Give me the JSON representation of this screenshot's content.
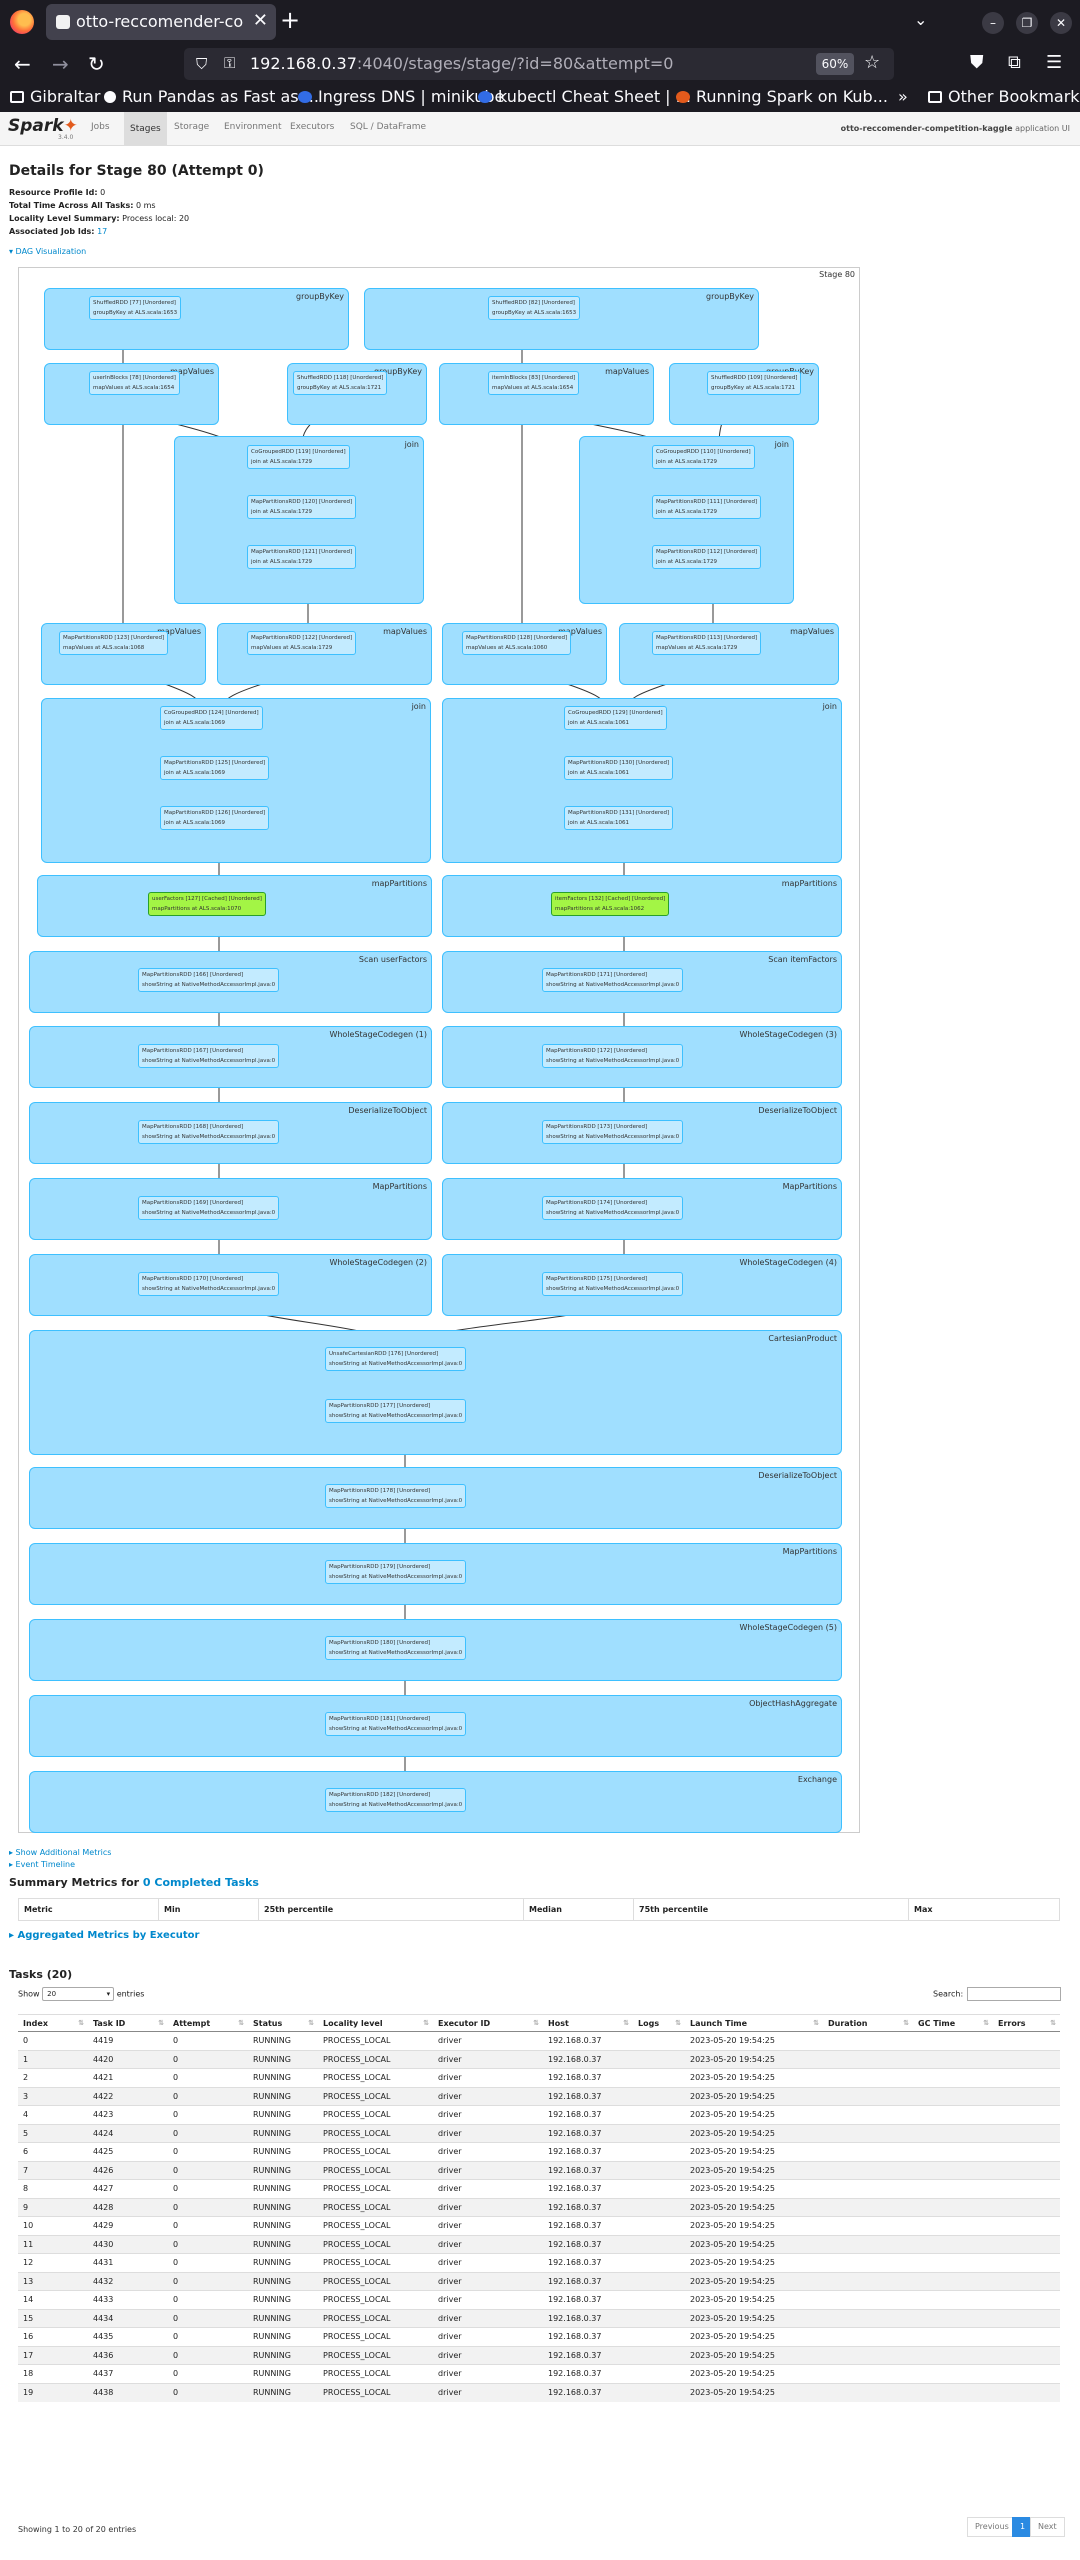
{
  "browser": {
    "tab_title": "otto-reccomender-compe",
    "url_host": "192.168.0.37",
    "url_path": ":4040/stages/stage/?id=80&attempt=0",
    "zoom": "60%",
    "bookmarks": [
      "Gibraltar",
      "Run Pandas as Fast as ...",
      "Ingress DNS | minikube",
      "kubectl Cheat Sheet | ...",
      "Running Spark on Kub...",
      "Other Bookmarks"
    ]
  },
  "spark": {
    "version": "3.4.0",
    "tabs": [
      "Jobs",
      "Stages",
      "Storage",
      "Environment",
      "Executors",
      "SQL / DataFrame"
    ],
    "app_name": "otto-reccomender-competition-kaggle",
    "app_suffix": "application UI"
  },
  "stage": {
    "title": "Details for Stage 80 (Attempt 0)",
    "resource_profile_label": "Resource Profile Id:",
    "resource_profile": "0",
    "total_time_label": "Total Time Across All Tasks:",
    "total_time": "0 ms",
    "locality_label": "Locality Level Summary:",
    "locality": "Process local: 20",
    "jobs_label": "Associated Job Ids:",
    "job_ids": "17",
    "dag_toggle": "▾ DAG Visualization",
    "dag_label": "Stage 80"
  },
  "dag": {
    "clusters": [
      {
        "label": "groupByKey",
        "nodes": [
          {
            "l1": "ShuffledRDD [77] [Unordered]",
            "l2": "groupByKey at ALS.scala:1653"
          }
        ]
      },
      {
        "label": "groupByKey",
        "nodes": [
          {
            "l1": "ShuffledRDD [82] [Unordered]",
            "l2": "groupByKey at ALS.scala:1653"
          }
        ]
      },
      {
        "label": "mapValues",
        "nodes": [
          {
            "l1": "userInBlocks [78] [Unordered]",
            "l2": "mapValues at ALS.scala:1654"
          }
        ]
      },
      {
        "label": "groupByKey",
        "nodes": [
          {
            "l1": "ShuffledRDD [118] [Unordered]",
            "l2": "groupByKey at ALS.scala:1721"
          }
        ]
      },
      {
        "label": "mapValues",
        "nodes": [
          {
            "l1": "itemInBlocks [83] [Unordered]",
            "l2": "mapValues at ALS.scala:1654"
          }
        ]
      },
      {
        "label": "groupByKey",
        "nodes": [
          {
            "l1": "ShuffledRDD [109] [Unordered]",
            "l2": "groupByKey at ALS.scala:1721"
          }
        ]
      },
      {
        "label": "join",
        "nodes": [
          {
            "l1": "CoGroupedRDD [119] [Unordered]",
            "l2": "join at ALS.scala:1729"
          },
          {
            "l1": "MapPartitionsRDD [120] [Unordered]",
            "l2": "join at ALS.scala:1729"
          },
          {
            "l1": "MapPartitionsRDD [121] [Unordered]",
            "l2": "join at ALS.scala:1729"
          }
        ]
      },
      {
        "label": "join",
        "nodes": [
          {
            "l1": "CoGroupedRDD [110] [Unordered]",
            "l2": "join at ALS.scala:1729"
          },
          {
            "l1": "MapPartitionsRDD [111] [Unordered]",
            "l2": "join at ALS.scala:1729"
          },
          {
            "l1": "MapPartitionsRDD [112] [Unordered]",
            "l2": "join at ALS.scala:1729"
          }
        ]
      },
      {
        "label": "mapValues",
        "nodes": [
          {
            "l1": "MapPartitionsRDD [123] [Unordered]",
            "l2": "mapValues at ALS.scala:1068"
          }
        ]
      },
      {
        "label": "mapValues",
        "nodes": [
          {
            "l1": "MapPartitionsRDD [122] [Unordered]",
            "l2": "mapValues at ALS.scala:1729"
          }
        ]
      },
      {
        "label": "mapValues",
        "nodes": [
          {
            "l1": "MapPartitionsRDD [128] [Unordered]",
            "l2": "mapValues at ALS.scala:1060"
          }
        ]
      },
      {
        "label": "mapValues",
        "nodes": [
          {
            "l1": "MapPartitionsRDD [113] [Unordered]",
            "l2": "mapValues at ALS.scala:1729"
          }
        ]
      },
      {
        "label": "join",
        "nodes": [
          {
            "l1": "CoGroupedRDD [124] [Unordered]",
            "l2": "join at ALS.scala:1069"
          },
          {
            "l1": "MapPartitionsRDD [125] [Unordered]",
            "l2": "join at ALS.scala:1069"
          },
          {
            "l1": "MapPartitionsRDD [126] [Unordered]",
            "l2": "join at ALS.scala:1069"
          }
        ]
      },
      {
        "label": "join",
        "nodes": [
          {
            "l1": "CoGroupedRDD [129] [Unordered]",
            "l2": "join at ALS.scala:1061"
          },
          {
            "l1": "MapPartitionsRDD [130] [Unordered]",
            "l2": "join at ALS.scala:1061"
          },
          {
            "l1": "MapPartitionsRDD [131] [Unordered]",
            "l2": "join at ALS.scala:1061"
          }
        ]
      },
      {
        "label": "mapPartitions",
        "nodes": [
          {
            "l1": "userFactors [127] [Cached] [Unordered]",
            "l2": "mapPartitions at ALS.scala:1070",
            "cached": true
          }
        ]
      },
      {
        "label": "mapPartitions",
        "nodes": [
          {
            "l1": "itemFactors [132] [Cached] [Unordered]",
            "l2": "mapPartitions at ALS.scala:1062",
            "cached": true
          }
        ]
      },
      {
        "label": "Scan userFactors",
        "nodes": [
          {
            "l1": "MapPartitionsRDD [166] [Unordered]",
            "l2": "showString at NativeMethodAccessorImpl.java:0"
          }
        ]
      },
      {
        "label": "Scan itemFactors",
        "nodes": [
          {
            "l1": "MapPartitionsRDD [171] [Unordered]",
            "l2": "showString at NativeMethodAccessorImpl.java:0"
          }
        ]
      },
      {
        "label": "WholeStageCodegen (1)",
        "nodes": [
          {
            "l1": "MapPartitionsRDD [167] [Unordered]",
            "l2": "showString at NativeMethodAccessorImpl.java:0"
          }
        ]
      },
      {
        "label": "WholeStageCodegen (3)",
        "nodes": [
          {
            "l1": "MapPartitionsRDD [172] [Unordered]",
            "l2": "showString at NativeMethodAccessorImpl.java:0"
          }
        ]
      },
      {
        "label": "DeserializeToObject",
        "nodes": [
          {
            "l1": "MapPartitionsRDD [168] [Unordered]",
            "l2": "showString at NativeMethodAccessorImpl.java:0"
          }
        ]
      },
      {
        "label": "DeserializeToObject",
        "nodes": [
          {
            "l1": "MapPartitionsRDD [173] [Unordered]",
            "l2": "showString at NativeMethodAccessorImpl.java:0"
          }
        ]
      },
      {
        "label": "MapPartitions",
        "nodes": [
          {
            "l1": "MapPartitionsRDD [169] [Unordered]",
            "l2": "showString at NativeMethodAccessorImpl.java:0"
          }
        ]
      },
      {
        "label": "MapPartitions",
        "nodes": [
          {
            "l1": "MapPartitionsRDD [174] [Unordered]",
            "l2": "showString at NativeMethodAccessorImpl.java:0"
          }
        ]
      },
      {
        "label": "WholeStageCodegen (2)",
        "nodes": [
          {
            "l1": "MapPartitionsRDD [170] [Unordered]",
            "l2": "showString at NativeMethodAccessorImpl.java:0"
          }
        ]
      },
      {
        "label": "WholeStageCodegen (4)",
        "nodes": [
          {
            "l1": "MapPartitionsRDD [175] [Unordered]",
            "l2": "showString at NativeMethodAccessorImpl.java:0"
          }
        ]
      },
      {
        "label": "CartesianProduct",
        "nodes": [
          {
            "l1": "UnsafeCartesianRDD [176] [Unordered]",
            "l2": "showString at NativeMethodAccessorImpl.java:0"
          },
          {
            "l1": "MapPartitionsRDD [177] [Unordered]",
            "l2": "showString at NativeMethodAccessorImpl.java:0"
          }
        ]
      },
      {
        "label": "DeserializeToObject",
        "nodes": [
          {
            "l1": "MapPartitionsRDD [178] [Unordered]",
            "l2": "showString at NativeMethodAccessorImpl.java:0"
          }
        ]
      },
      {
        "label": "MapPartitions",
        "nodes": [
          {
            "l1": "MapPartitionsRDD [179] [Unordered]",
            "l2": "showString at NativeMethodAccessorImpl.java:0"
          }
        ]
      },
      {
        "label": "WholeStageCodegen (5)",
        "nodes": [
          {
            "l1": "MapPartitionsRDD [180] [Unordered]",
            "l2": "showString at NativeMethodAccessorImpl.java:0"
          }
        ]
      },
      {
        "label": "ObjectHashAggregate",
        "nodes": [
          {
            "l1": "MapPartitionsRDD [181] [Unordered]",
            "l2": "showString at NativeMethodAccessorImpl.java:0"
          }
        ]
      },
      {
        "label": "Exchange",
        "nodes": [
          {
            "l1": "MapPartitionsRDD [182] [Unordered]",
            "l2": "showString at NativeMethodAccessorImpl.java:0"
          }
        ]
      }
    ]
  },
  "links": {
    "show_metrics": "▸ Show Additional Metrics",
    "event_timeline": "▸ Event Timeline"
  },
  "summary": {
    "title": "Summary Metrics for",
    "link": "0 Completed Tasks",
    "headers": [
      "Metric",
      "Min",
      "25th percentile",
      "Median",
      "75th percentile",
      "Max"
    ]
  },
  "aggregated": "▸ Aggregated Metrics by Executor",
  "tasks": {
    "title": "Tasks (20)",
    "show_label": "Show",
    "show_value": "20",
    "entries_label": "entries",
    "search_label": "Search:",
    "headers": [
      "Index",
      "Task ID",
      "Attempt",
      "Status",
      "Locality level",
      "Executor ID",
      "Host",
      "Logs",
      "Launch Time",
      "Duration",
      "GC Time",
      "Errors"
    ],
    "rows": [
      [
        "0",
        "4419",
        "0",
        "RUNNING",
        "PROCESS_LOCAL",
        "driver",
        "192.168.0.37",
        "",
        "2023-05-20 19:54:25",
        "",
        "",
        ""
      ],
      [
        "1",
        "4420",
        "0",
        "RUNNING",
        "PROCESS_LOCAL",
        "driver",
        "192.168.0.37",
        "",
        "2023-05-20 19:54:25",
        "",
        "",
        ""
      ],
      [
        "2",
        "4421",
        "0",
        "RUNNING",
        "PROCESS_LOCAL",
        "driver",
        "192.168.0.37",
        "",
        "2023-05-20 19:54:25",
        "",
        "",
        ""
      ],
      [
        "3",
        "4422",
        "0",
        "RUNNING",
        "PROCESS_LOCAL",
        "driver",
        "192.168.0.37",
        "",
        "2023-05-20 19:54:25",
        "",
        "",
        ""
      ],
      [
        "4",
        "4423",
        "0",
        "RUNNING",
        "PROCESS_LOCAL",
        "driver",
        "192.168.0.37",
        "",
        "2023-05-20 19:54:25",
        "",
        "",
        ""
      ],
      [
        "5",
        "4424",
        "0",
        "RUNNING",
        "PROCESS_LOCAL",
        "driver",
        "192.168.0.37",
        "",
        "2023-05-20 19:54:25",
        "",
        "",
        ""
      ],
      [
        "6",
        "4425",
        "0",
        "RUNNING",
        "PROCESS_LOCAL",
        "driver",
        "192.168.0.37",
        "",
        "2023-05-20 19:54:25",
        "",
        "",
        ""
      ],
      [
        "7",
        "4426",
        "0",
        "RUNNING",
        "PROCESS_LOCAL",
        "driver",
        "192.168.0.37",
        "",
        "2023-05-20 19:54:25",
        "",
        "",
        ""
      ],
      [
        "8",
        "4427",
        "0",
        "RUNNING",
        "PROCESS_LOCAL",
        "driver",
        "192.168.0.37",
        "",
        "2023-05-20 19:54:25",
        "",
        "",
        ""
      ],
      [
        "9",
        "4428",
        "0",
        "RUNNING",
        "PROCESS_LOCAL",
        "driver",
        "192.168.0.37",
        "",
        "2023-05-20 19:54:25",
        "",
        "",
        ""
      ],
      [
        "10",
        "4429",
        "0",
        "RUNNING",
        "PROCESS_LOCAL",
        "driver",
        "192.168.0.37",
        "",
        "2023-05-20 19:54:25",
        "",
        "",
        ""
      ],
      [
        "11",
        "4430",
        "0",
        "RUNNING",
        "PROCESS_LOCAL",
        "driver",
        "192.168.0.37",
        "",
        "2023-05-20 19:54:25",
        "",
        "",
        ""
      ],
      [
        "12",
        "4431",
        "0",
        "RUNNING",
        "PROCESS_LOCAL",
        "driver",
        "192.168.0.37",
        "",
        "2023-05-20 19:54:25",
        "",
        "",
        ""
      ],
      [
        "13",
        "4432",
        "0",
        "RUNNING",
        "PROCESS_LOCAL",
        "driver",
        "192.168.0.37",
        "",
        "2023-05-20 19:54:25",
        "",
        "",
        ""
      ],
      [
        "14",
        "4433",
        "0",
        "RUNNING",
        "PROCESS_LOCAL",
        "driver",
        "192.168.0.37",
        "",
        "2023-05-20 19:54:25",
        "",
        "",
        ""
      ],
      [
        "15",
        "4434",
        "0",
        "RUNNING",
        "PROCESS_LOCAL",
        "driver",
        "192.168.0.37",
        "",
        "2023-05-20 19:54:25",
        "",
        "",
        ""
      ],
      [
        "16",
        "4435",
        "0",
        "RUNNING",
        "PROCESS_LOCAL",
        "driver",
        "192.168.0.37",
        "",
        "2023-05-20 19:54:25",
        "",
        "",
        ""
      ],
      [
        "17",
        "4436",
        "0",
        "RUNNING",
        "PROCESS_LOCAL",
        "driver",
        "192.168.0.37",
        "",
        "2023-05-20 19:54:25",
        "",
        "",
        ""
      ],
      [
        "18",
        "4437",
        "0",
        "RUNNING",
        "PROCESS_LOCAL",
        "driver",
        "192.168.0.37",
        "",
        "2023-05-20 19:54:25",
        "",
        "",
        ""
      ],
      [
        "19",
        "4438",
        "0",
        "RUNNING",
        "PROCESS_LOCAL",
        "driver",
        "192.168.0.37",
        "",
        "2023-05-20 19:54:25",
        "",
        "",
        ""
      ]
    ],
    "showing": "Showing 1 to 20 of 20 entries",
    "previous": "Previous",
    "page": "1",
    "next": "Next"
  }
}
